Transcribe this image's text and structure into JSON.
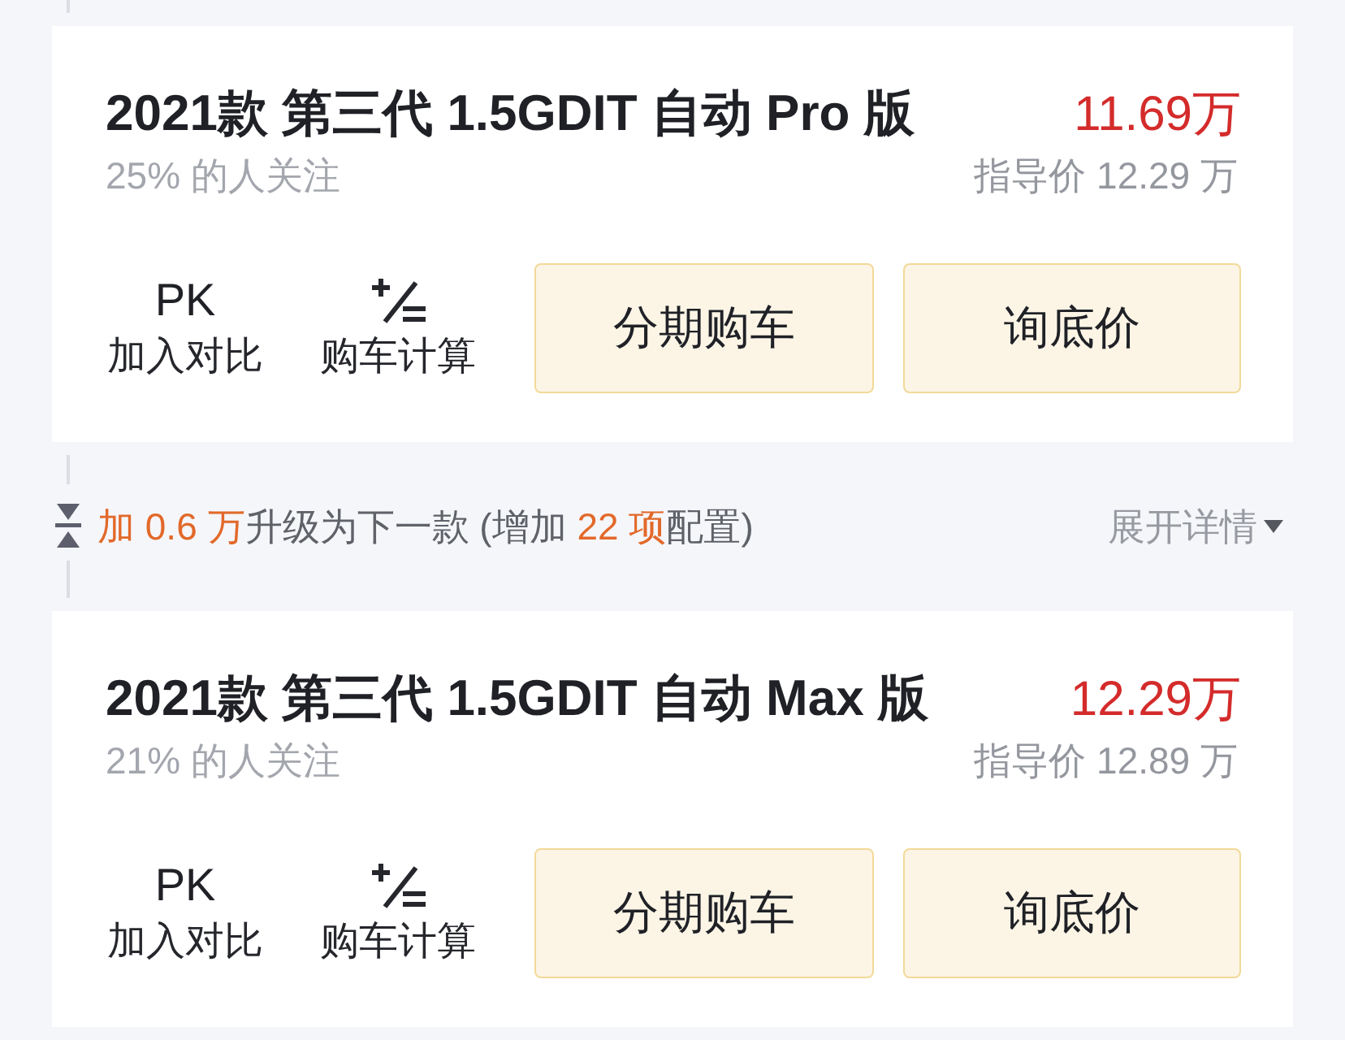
{
  "list": [
    {
      "kind": "trim",
      "title": "2021款 第三代 1.5GDIT 自动 Pro 版",
      "price": "11.69万",
      "attention": "25% 的人关注",
      "guide_price": "指导价 12.29 万",
      "actions": [
        {
          "kind": "compare",
          "glyph": "PK",
          "label": "加入对比"
        },
        {
          "kind": "calculator",
          "label": "购车计算"
        }
      ],
      "buttons": [
        "分期购车",
        "询底价"
      ]
    },
    {
      "kind": "upgrade",
      "segments": [
        {
          "text": "加 0.6 万",
          "highlight": true
        },
        {
          "text": "升级为下一款 (增加 ",
          "highlight": false
        },
        {
          "text": "22 项",
          "highlight": true
        },
        {
          "text": "配置)",
          "highlight": false
        }
      ],
      "expand": {
        "label": "展开详情",
        "expanded": false
      }
    },
    {
      "kind": "trim",
      "title": "2021款 第三代 1.5GDIT 自动 Max 版",
      "price": "12.29万",
      "attention": "21% 的人关注",
      "guide_price": "指导价 12.89 万",
      "actions": [
        {
          "kind": "compare",
          "glyph": "PK",
          "label": "加入对比"
        },
        {
          "kind": "calculator",
          "label": "购车计算"
        }
      ],
      "buttons": [
        "分期购车",
        "询底价"
      ]
    }
  ]
}
